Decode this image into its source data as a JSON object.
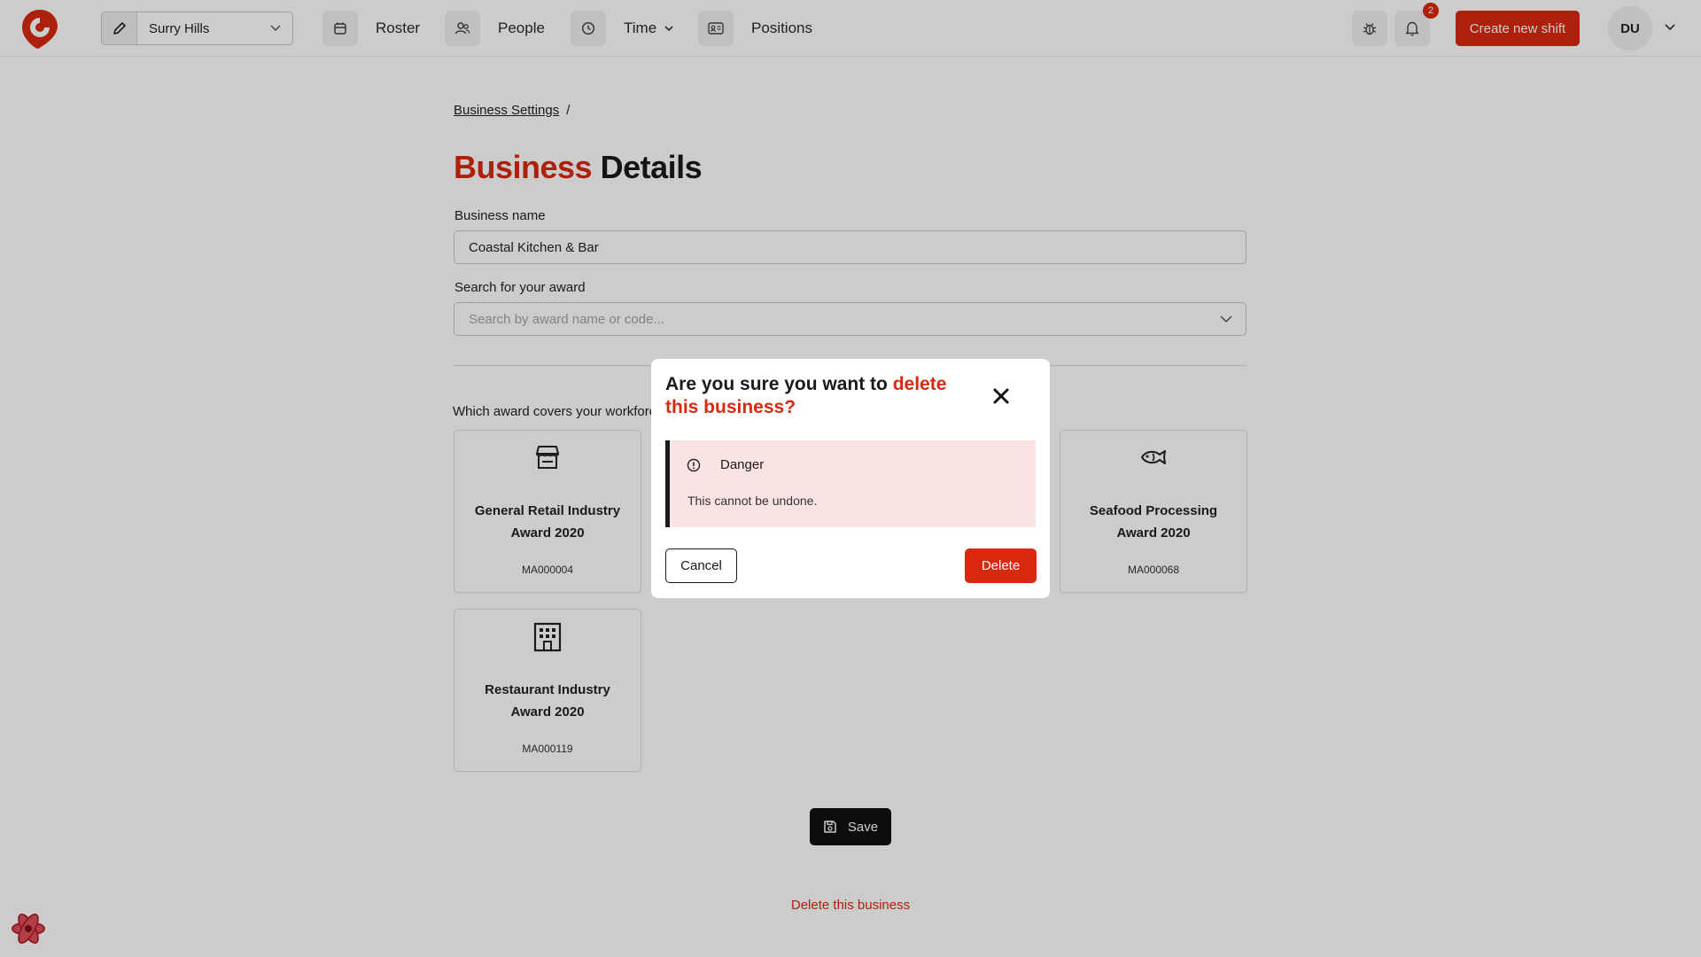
{
  "header": {
    "location": "Surry Hills",
    "nav": {
      "roster": "Roster",
      "people": "People",
      "time": "Time",
      "positions": "Positions"
    },
    "notification_count": "2",
    "create_label": "Create new shift",
    "user_initials": "DU"
  },
  "breadcrumb": {
    "parent": "Business Settings",
    "separator": "/"
  },
  "page": {
    "title_accent": "Business",
    "title_rest": "Details"
  },
  "form": {
    "business_name_label": "Business name",
    "business_name_value": "Coastal Kitchen & Bar",
    "award_search_label": "Search for your award",
    "award_search_placeholder": "Search by award name or code...",
    "which_award_label": "Which award covers your workforce?"
  },
  "awards": [
    {
      "name": "General Retail Industry Award 2020",
      "code": "MA000004",
      "icon": "store-icon"
    },
    {
      "name": "Seafood Processing Award 2020",
      "code": "MA000068",
      "icon": "fish-icon"
    },
    {
      "name": "Restaurant Industry Award 2020",
      "code": "MA000119",
      "icon": "building-icon"
    }
  ],
  "actions": {
    "save_label": "Save",
    "delete_business_label": "Delete this business"
  },
  "modal": {
    "title_prefix": "Are you sure you want to ",
    "title_accent": "delete this business?",
    "alert_title": "Danger",
    "alert_message": "This cannot be undone.",
    "cancel_label": "Cancel",
    "delete_label": "Delete"
  },
  "colors": {
    "brand_red": "#d8290f",
    "alert_bg": "#fbe3e3",
    "overlay": "rgba(0,0,0,0.2)"
  }
}
